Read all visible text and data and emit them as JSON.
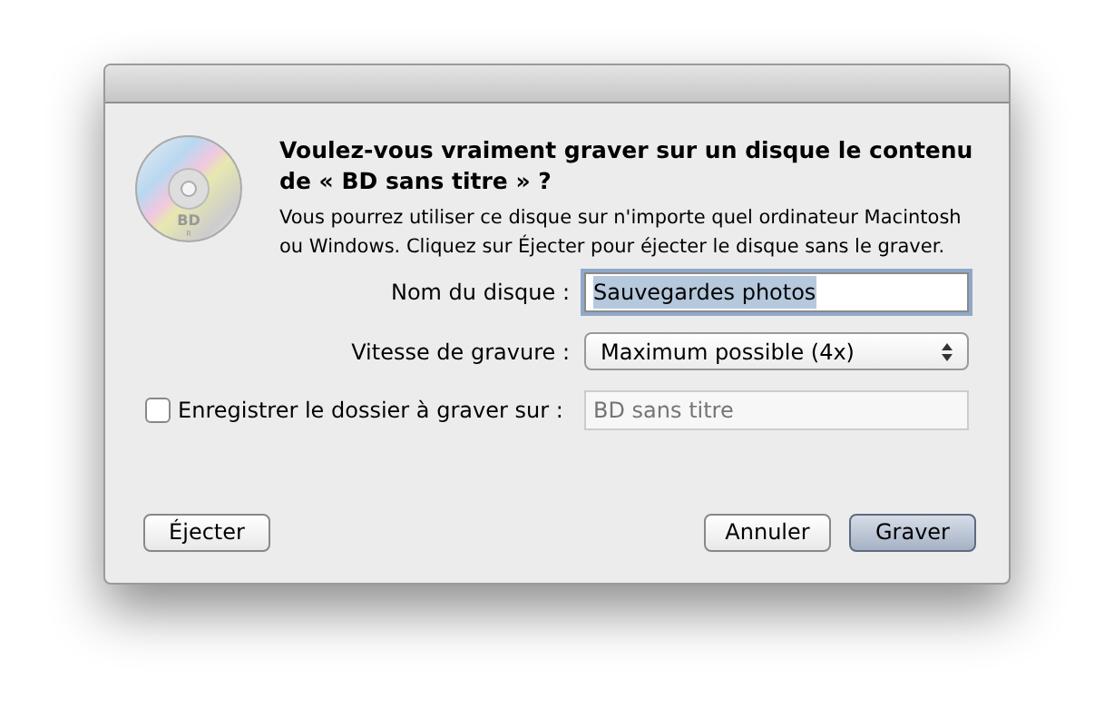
{
  "dialog": {
    "icon_label": "BD",
    "icon_sublabel": "R",
    "title": "Voulez-vous vraiment graver sur un disque le contenu de « BD sans titre » ?",
    "message": "Vous pourrez utiliser ce disque sur n'importe quel ordinateur Macintosh ou Windows. Cliquez sur Éjecter pour éjecter le disque sans le graver.",
    "fields": [
      {
        "kind": "text",
        "label": "Nom du disque :",
        "value": "Sauvegardes photos",
        "text_selected": true
      },
      {
        "kind": "popup",
        "label": "Vitesse de gravure :",
        "value": "Maximum possible (4x)"
      },
      {
        "kind": "checkbox-text",
        "label": "Enregistrer le dossier à graver sur :",
        "checked": false,
        "placeholder": "BD sans titre",
        "disabled": true
      }
    ],
    "left_buttons": [
      {
        "label": "Éjecter",
        "default": false
      }
    ],
    "right_buttons": [
      {
        "label": "Annuler",
        "default": false
      },
      {
        "label": "Graver",
        "default": true
      }
    ]
  }
}
